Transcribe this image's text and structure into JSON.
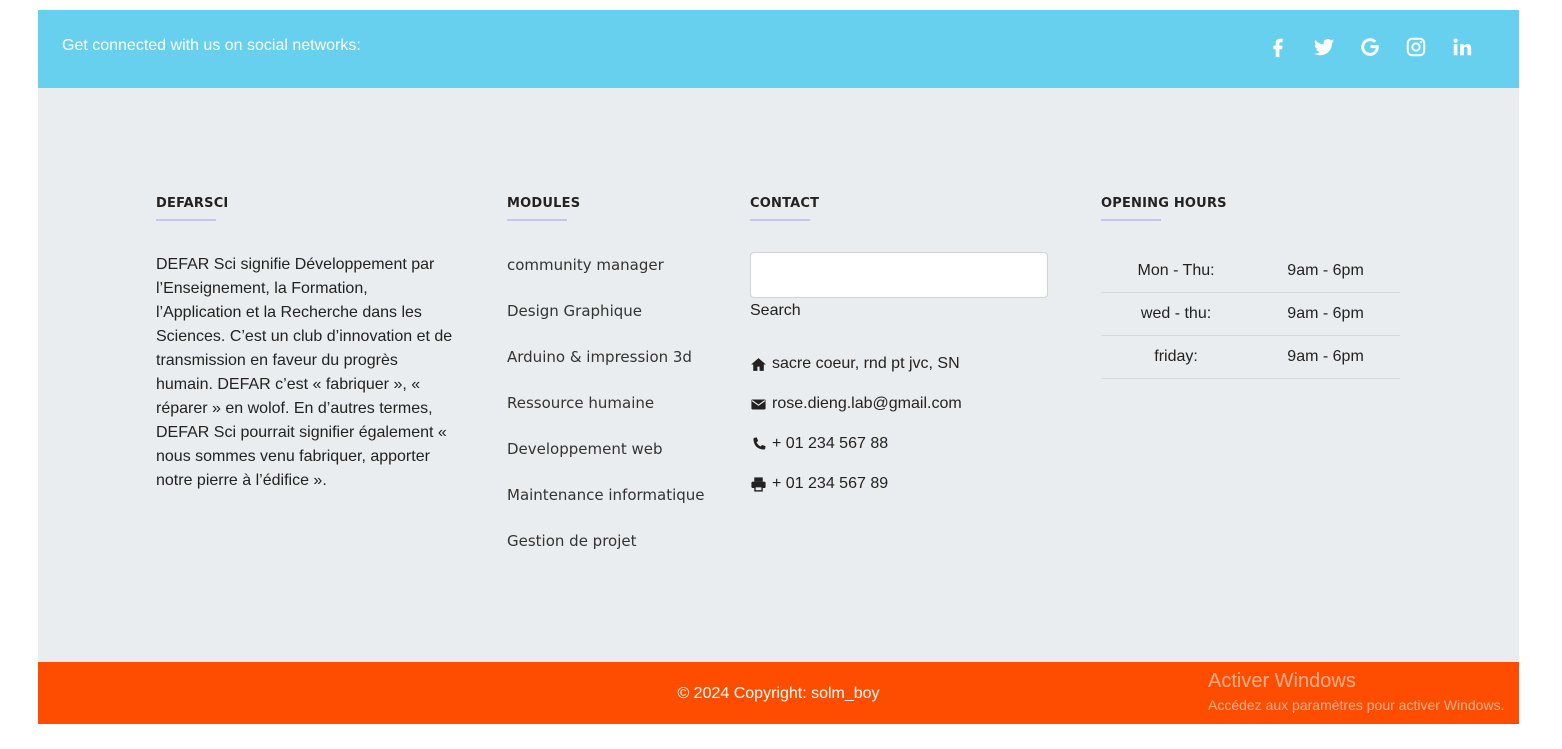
{
  "social": {
    "text": "Get connected with us on social networks:",
    "icons": [
      "facebook-icon",
      "twitter-icon",
      "google-icon",
      "instagram-icon",
      "linkedin-icon"
    ]
  },
  "about": {
    "title": "DEFARSCI",
    "text": "DEFAR Sci signifie Développement par l’Enseignement, la Formation, l’Application et la Recherche dans les Sciences. C’est un club d’innovation et de transmission en faveur du progrès humain. DEFAR c’est « fabriquer », « réparer » en wolof. En d’autres termes, DEFAR Sci pourrait signifier également « nous sommes venu fabriquer, apporter notre pierre à l’édifice »."
  },
  "modules": {
    "title": "MODULES",
    "items": [
      "community manager",
      "Design Graphique",
      "Arduino & impression 3d",
      "Ressource humaine",
      "Developpement web",
      "Maintenance informatique",
      "Gestion de projet"
    ]
  },
  "contact": {
    "title": "CONTACT",
    "search_label": "Search",
    "address": "sacre coeur, rnd pt jvc, SN",
    "email": "rose.dieng.lab@gmail.com",
    "phone": "+ 01 234 567 88",
    "fax": "+ 01 234 567 89"
  },
  "hours": {
    "title": "OPENING HOURS",
    "rows": [
      {
        "day": "Mon - Thu:",
        "time": "9am - 6pm"
      },
      {
        "day": "wed - thu:",
        "time": "9am - 6pm"
      },
      {
        "day": "friday:",
        "time": "9am - 6pm"
      }
    ]
  },
  "footer": {
    "copyright": "© 2024 Copyright: solm_boy"
  },
  "watermark": {
    "title": "Activer Windows",
    "subtitle": "Accédez aux paramètres pour activer Windows."
  },
  "colors": {
    "social_bar": "#66d0ee",
    "main_bg": "#e9edf0",
    "footer": "#ff4d00"
  }
}
